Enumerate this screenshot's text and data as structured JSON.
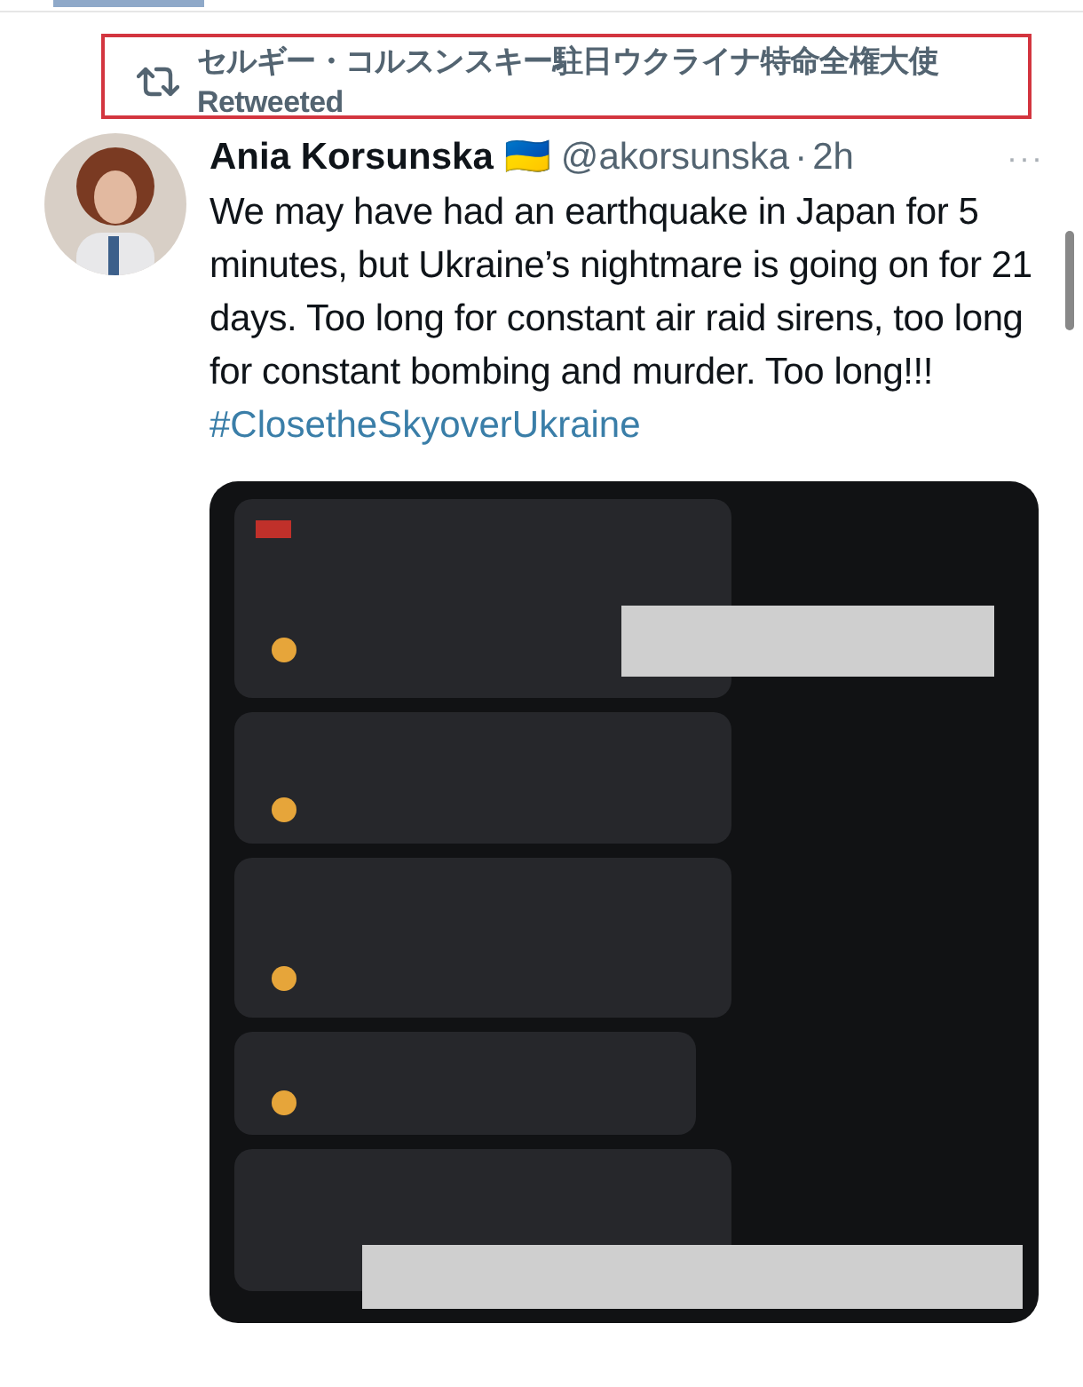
{
  "retweet": {
    "label": "セルギー・コルスンスキー駐日ウクライナ特命全権大使 Retweeted"
  },
  "tweet": {
    "name": "Ania Korsunska",
    "flag": "🇺🇦",
    "handle": "@akorsunska",
    "separator": "·",
    "time": "2h",
    "more": "···",
    "text": "We may have had an earthquake in Japan for 5 minutes, but Ukraine’s nightmare is going on for 21 days. Too long for constant air raid sirens, too long for constant bombing and murder. Too long!!!",
    "hashtag": "#ClosetheSkyoverUkraine"
  }
}
